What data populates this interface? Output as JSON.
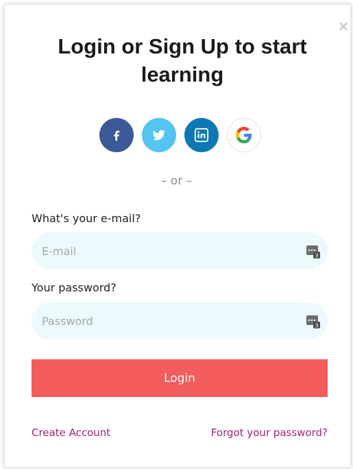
{
  "title": "Login or Sign Up to start learning",
  "close_symbol": "×",
  "social_buttons": [
    {
      "name": "facebook",
      "icon": "facebook-icon",
      "color": "#3b5998"
    },
    {
      "name": "twitter",
      "icon": "twitter-icon",
      "color": "#55c4f0"
    },
    {
      "name": "linkedin",
      "icon": "linkedin-icon",
      "color": "#0e78b4"
    },
    {
      "name": "google",
      "icon": "google-icon",
      "color": "#ffffff"
    }
  ],
  "divider_text": "– or –",
  "email": {
    "label": "What's your e-mail?",
    "placeholder": "E-mail",
    "value": ""
  },
  "password": {
    "label": "Your password?",
    "placeholder": "Password",
    "value": ""
  },
  "login_button": "Login",
  "links": {
    "create_account": "Create Account",
    "forgot_password": "Forgot your password?"
  },
  "colors": {
    "accent": "#f25c5c",
    "link": "#a0256f",
    "input_bg": "#ecfafd"
  }
}
